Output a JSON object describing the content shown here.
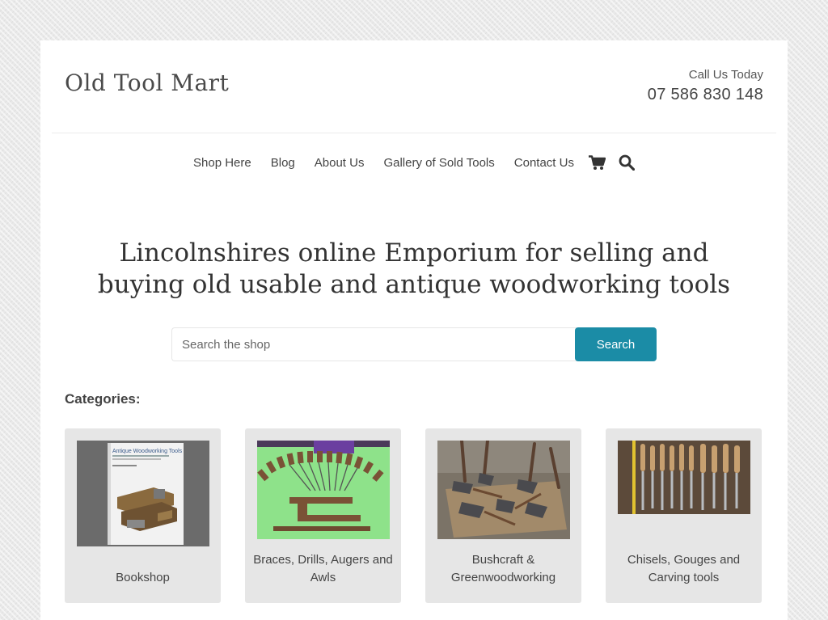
{
  "site": {
    "title": "Old Tool Mart"
  },
  "contact": {
    "label": "Call Us Today",
    "phone": "07 586 830 148"
  },
  "nav": {
    "items": [
      "Shop Here",
      "Blog",
      "About Us",
      "Gallery of Sold Tools",
      "Contact Us"
    ],
    "icons": [
      "cart-icon",
      "search-icon"
    ]
  },
  "hero": {
    "heading": "Lincolnshires online Emporium for selling and buying old usable and antique woodworking tools"
  },
  "search": {
    "placeholder": "Search the shop",
    "button": "Search"
  },
  "categories": {
    "title": "Categories:",
    "items": [
      {
        "label": "Bookshop",
        "book_title": "Antique Woodworking Tools"
      },
      {
        "label": "Braces, Drills, Augers and Awls"
      },
      {
        "label": "Bushcraft & Greenwoodworking"
      },
      {
        "label": "Chisels, Gouges and Carving tools"
      }
    ]
  },
  "colors": {
    "accent": "#1b8ca6",
    "card_bg": "#e6e6e6"
  }
}
